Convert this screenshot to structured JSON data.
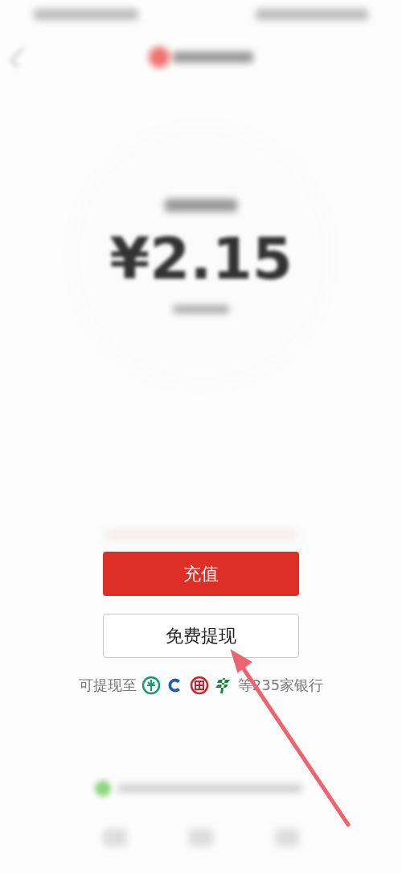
{
  "balance": {
    "amount": "¥2.15"
  },
  "buttons": [
    {
      "label": "充值",
      "kind": "primary"
    },
    {
      "label": "免费提现",
      "kind": "outline"
    }
  ],
  "banks_note": {
    "prefix": "可提现至",
    "suffix": "等235家银行"
  }
}
